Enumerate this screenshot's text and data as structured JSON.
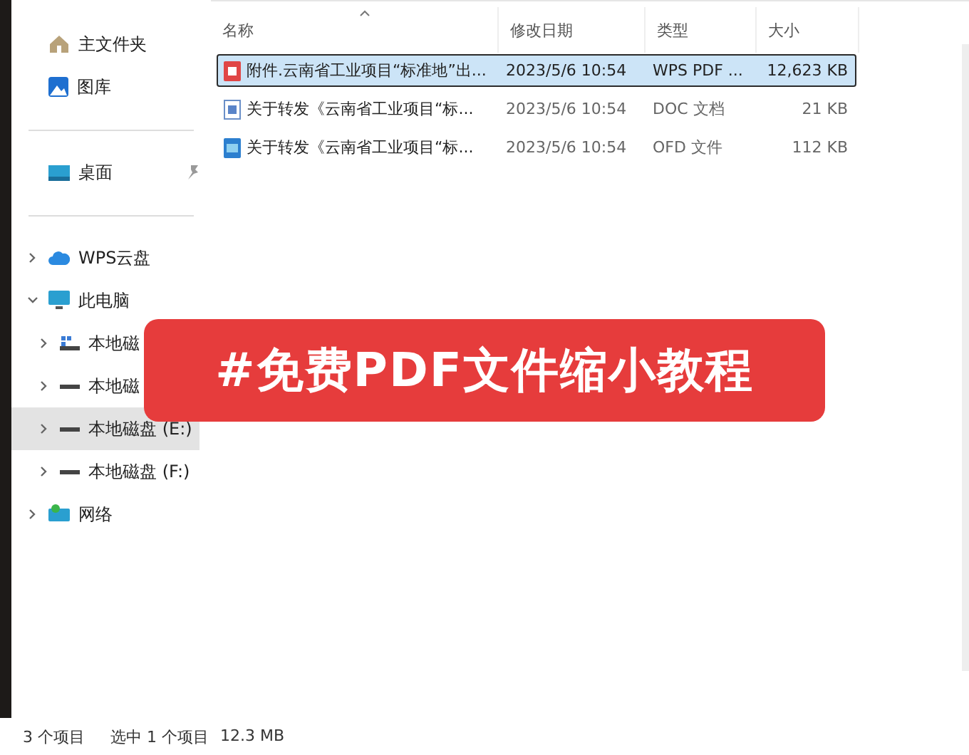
{
  "navigation": {
    "quick_access": [
      {
        "label": "主文件夹"
      },
      {
        "label": "图库"
      }
    ],
    "pinned": [
      {
        "label": "桌面",
        "pinned": true
      }
    ],
    "tree": [
      {
        "label": "WPS云盘",
        "expanded": false,
        "selected": false
      },
      {
        "label": "此电脑",
        "expanded": true,
        "selected": false,
        "children": [
          {
            "label": "本地磁",
            "expanded": false,
            "selected": false
          },
          {
            "label": "本地磁",
            "expanded": false,
            "selected": false
          },
          {
            "label": "本地磁盘 (E:)",
            "expanded": false,
            "selected": true
          },
          {
            "label": "本地磁盘 (F:)",
            "expanded": false,
            "selected": false
          }
        ]
      },
      {
        "label": "网络",
        "expanded": false,
        "selected": false
      }
    ]
  },
  "table": {
    "columns": [
      "名称",
      "修改日期",
      "类型",
      "大小"
    ],
    "rows": [
      {
        "name": "附件.云南省工业项目“标准地”出...",
        "modified": "2023/5/6 10:54",
        "type": "WPS PDF ...",
        "size": "12,623 KB",
        "selected": true
      },
      {
        "name": "关于转发《云南省工业项目“标...",
        "modified": "2023/5/6 10:54",
        "type": "DOC 文档",
        "size": "21 KB",
        "selected": false
      },
      {
        "name": "关于转发《云南省工业项目“标...",
        "modified": "2023/5/6 10:54",
        "type": "OFD 文件",
        "size": "112 KB",
        "selected": false
      }
    ]
  },
  "banner": {
    "text": "#免费PDF文件缩小教程"
  },
  "status_bar": {
    "item_count": "3 个项目",
    "selection": "选中 1 个项目",
    "selection_size": "12.3 MB"
  }
}
